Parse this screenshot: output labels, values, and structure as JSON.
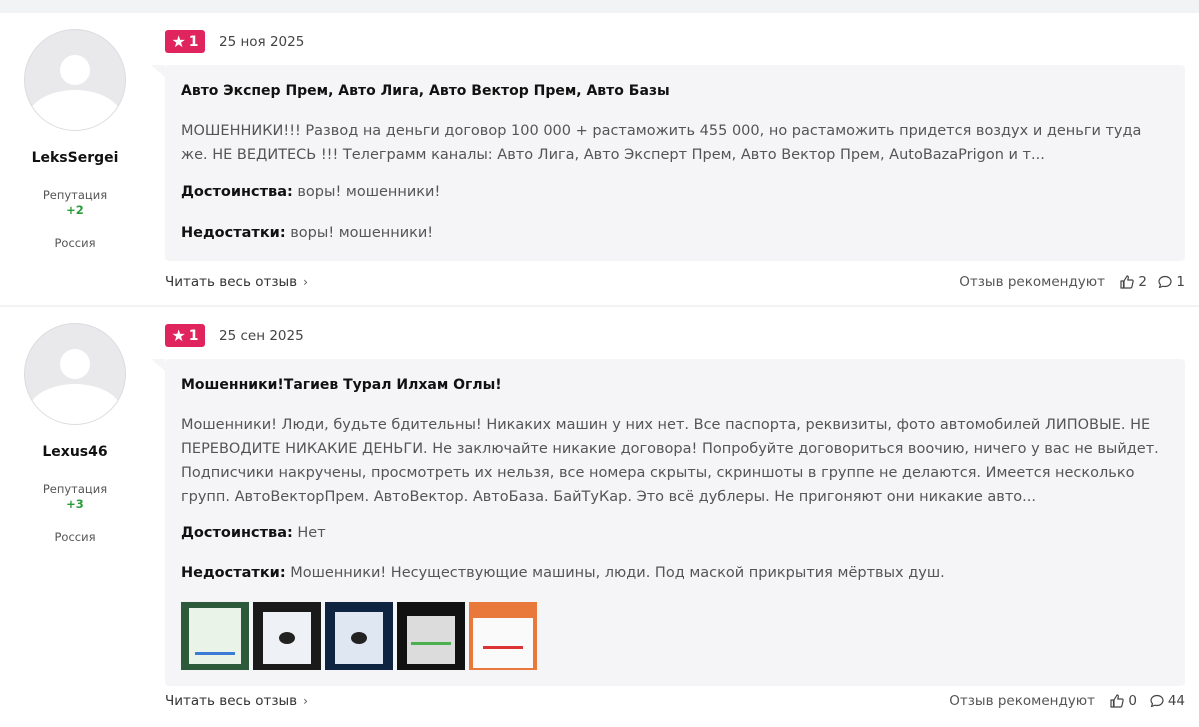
{
  "reviews": [
    {
      "author": {
        "name": "LeksSergei",
        "reputation_label": "Репутация",
        "reputation_value": "+2",
        "country": "Россия"
      },
      "rating": "1",
      "date": "25 ноя 2025",
      "title": "Авто Экспер Прем, Авто Лига, Авто Вектор Прем, Авто Базы",
      "text": "МОШЕННИКИ!!! Развод на деньги договор 100 000 + растаможить 455 000, но растаможить придется воздух и деньги туда же. НЕ ВЕДИТЕСЬ !!! Телеграмм каналы: Авто Лига, Авто Эксперт Прем, Авто Вектор Прем, AutoBazaPrigon и т...",
      "pros_label": "Достоинства:",
      "pros": "воры! мошенники!",
      "cons_label": "Недостатки:",
      "cons": "воры! мошенники!",
      "read_more": "Читать весь отзыв",
      "recommend_label": "Отзыв рекомендуют",
      "likes": "2",
      "comments": "1"
    },
    {
      "author": {
        "name": "Lexus46",
        "reputation_label": "Репутация",
        "reputation_value": "+3",
        "country": "Россия"
      },
      "rating": "1",
      "date": "25 сен 2025",
      "title": "Мошенники!Тагиев Турал Илхам Оглы!",
      "text": "Мошенники! Люди, будьте бдительны! Никаких машин у них нет. Все паспорта, реквизиты, фото автомобилей ЛИПОВЫЕ. НЕ ПЕРЕВОДИТЕ НИКАКИЕ ДЕНЬГИ. Не заключайте никакие договора! Попробуйте договориться воочию, ничего у вас не выйдет. Подписчики накручены, просмотреть их нельзя, все номера скрыты, скриншоты в группе не делаются. Имеется несколько групп. АвтоВекторПрем. АвтоВектор. АвтоБаза. БайТуКар. Это всё дублеры. Не пригоняют они никакие авто...",
      "pros_label": "Достоинства:",
      "pros": "Нет",
      "cons_label": "Недостатки:",
      "cons": "Мошенники! Несуществующие машины, люди. Под маской прикрытия мёртвых душ.",
      "photos": [
        "photo-1",
        "photo-2",
        "photo-3",
        "photo-4",
        "photo-5"
      ],
      "read_more": "Читать весь отзыв",
      "recommend_label": "Отзыв рекомендуют",
      "likes": "0",
      "comments": "44"
    }
  ],
  "colors": {
    "rating_badge": "#e0245e",
    "reputation_positive": "#2a9d3a",
    "card_background": "#f5f5f7"
  },
  "icons": [
    "star-icon",
    "chevron-right-icon",
    "thumbs-up-icon",
    "comment-icon",
    "user-placeholder-icon"
  ]
}
